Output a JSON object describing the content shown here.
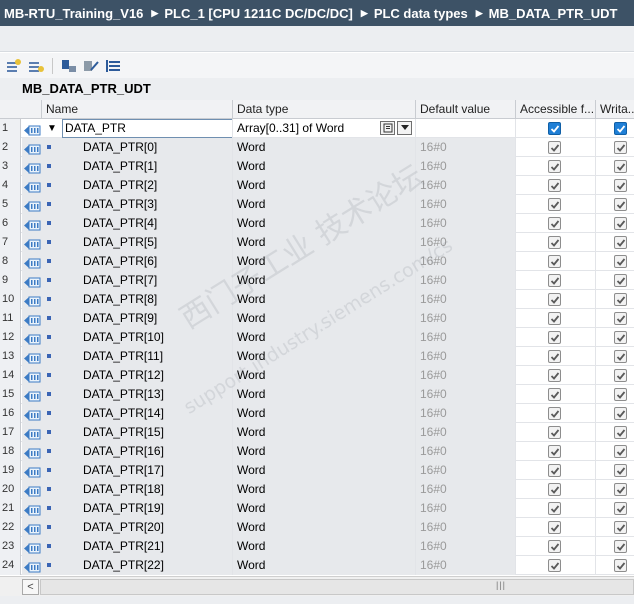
{
  "breadcrumb": [
    "MB-RTU_Training_V16",
    "PLC_1 [CPU 1211C DC/DC/DC]",
    "PLC data types",
    "MB_DATA_PTR_UDT"
  ],
  "toolbar": {
    "icons": [
      "insert-row-icon",
      "add-row-icon",
      "expand-icon",
      "collapse-icon",
      "list-view-icon"
    ]
  },
  "udt_title": "MB_DATA_PTR_UDT",
  "columns": {
    "name": "Name",
    "data_type": "Data type",
    "default_value": "Default value",
    "accessible": "Accessible f...",
    "writable": "Writa..."
  },
  "rows": [
    {
      "num": "1",
      "name": "DATA_PTR",
      "data_type": "Array[0..31] of Word",
      "default_value": "",
      "accessible": true,
      "writable": true
    },
    {
      "num": "2",
      "name": "DATA_PTR[0]",
      "data_type": "Word",
      "default_value": "16#0",
      "accessible": true,
      "writable": true
    },
    {
      "num": "3",
      "name": "DATA_PTR[1]",
      "data_type": "Word",
      "default_value": "16#0",
      "accessible": true,
      "writable": true
    },
    {
      "num": "4",
      "name": "DATA_PTR[2]",
      "data_type": "Word",
      "default_value": "16#0",
      "accessible": true,
      "writable": true
    },
    {
      "num": "5",
      "name": "DATA_PTR[3]",
      "data_type": "Word",
      "default_value": "16#0",
      "accessible": true,
      "writable": true
    },
    {
      "num": "6",
      "name": "DATA_PTR[4]",
      "data_type": "Word",
      "default_value": "16#0",
      "accessible": true,
      "writable": true
    },
    {
      "num": "7",
      "name": "DATA_PTR[5]",
      "data_type": "Word",
      "default_value": "16#0",
      "accessible": true,
      "writable": true
    },
    {
      "num": "8",
      "name": "DATA_PTR[6]",
      "data_type": "Word",
      "default_value": "16#0",
      "accessible": true,
      "writable": true
    },
    {
      "num": "9",
      "name": "DATA_PTR[7]",
      "data_type": "Word",
      "default_value": "16#0",
      "accessible": true,
      "writable": true
    },
    {
      "num": "10",
      "name": "DATA_PTR[8]",
      "data_type": "Word",
      "default_value": "16#0",
      "accessible": true,
      "writable": true
    },
    {
      "num": "11",
      "name": "DATA_PTR[9]",
      "data_type": "Word",
      "default_value": "16#0",
      "accessible": true,
      "writable": true
    },
    {
      "num": "12",
      "name": "DATA_PTR[10]",
      "data_type": "Word",
      "default_value": "16#0",
      "accessible": true,
      "writable": true
    },
    {
      "num": "13",
      "name": "DATA_PTR[11]",
      "data_type": "Word",
      "default_value": "16#0",
      "accessible": true,
      "writable": true
    },
    {
      "num": "14",
      "name": "DATA_PTR[12]",
      "data_type": "Word",
      "default_value": "16#0",
      "accessible": true,
      "writable": true
    },
    {
      "num": "15",
      "name": "DATA_PTR[13]",
      "data_type": "Word",
      "default_value": "16#0",
      "accessible": true,
      "writable": true
    },
    {
      "num": "16",
      "name": "DATA_PTR[14]",
      "data_type": "Word",
      "default_value": "16#0",
      "accessible": true,
      "writable": true
    },
    {
      "num": "17",
      "name": "DATA_PTR[15]",
      "data_type": "Word",
      "default_value": "16#0",
      "accessible": true,
      "writable": true
    },
    {
      "num": "18",
      "name": "DATA_PTR[16]",
      "data_type": "Word",
      "default_value": "16#0",
      "accessible": true,
      "writable": true
    },
    {
      "num": "19",
      "name": "DATA_PTR[17]",
      "data_type": "Word",
      "default_value": "16#0",
      "accessible": true,
      "writable": true
    },
    {
      "num": "20",
      "name": "DATA_PTR[18]",
      "data_type": "Word",
      "default_value": "16#0",
      "accessible": true,
      "writable": true
    },
    {
      "num": "21",
      "name": "DATA_PTR[19]",
      "data_type": "Word",
      "default_value": "16#0",
      "accessible": true,
      "writable": true
    },
    {
      "num": "22",
      "name": "DATA_PTR[20]",
      "data_type": "Word",
      "default_value": "16#0",
      "accessible": true,
      "writable": true
    },
    {
      "num": "23",
      "name": "DATA_PTR[21]",
      "data_type": "Word",
      "default_value": "16#0",
      "accessible": true,
      "writable": true
    },
    {
      "num": "24",
      "name": "DATA_PTR[22]",
      "data_type": "Word",
      "default_value": "16#0",
      "accessible": true,
      "writable": true
    }
  ],
  "watermark": {
    "line1": "西门子工业 技术论坛",
    "line2": "support.industry.siemens.com/cs"
  },
  "colors": {
    "titlebar": "#3d5266",
    "checkbox_active": "#1f7fd6",
    "row_marker": "#3a64b4"
  }
}
